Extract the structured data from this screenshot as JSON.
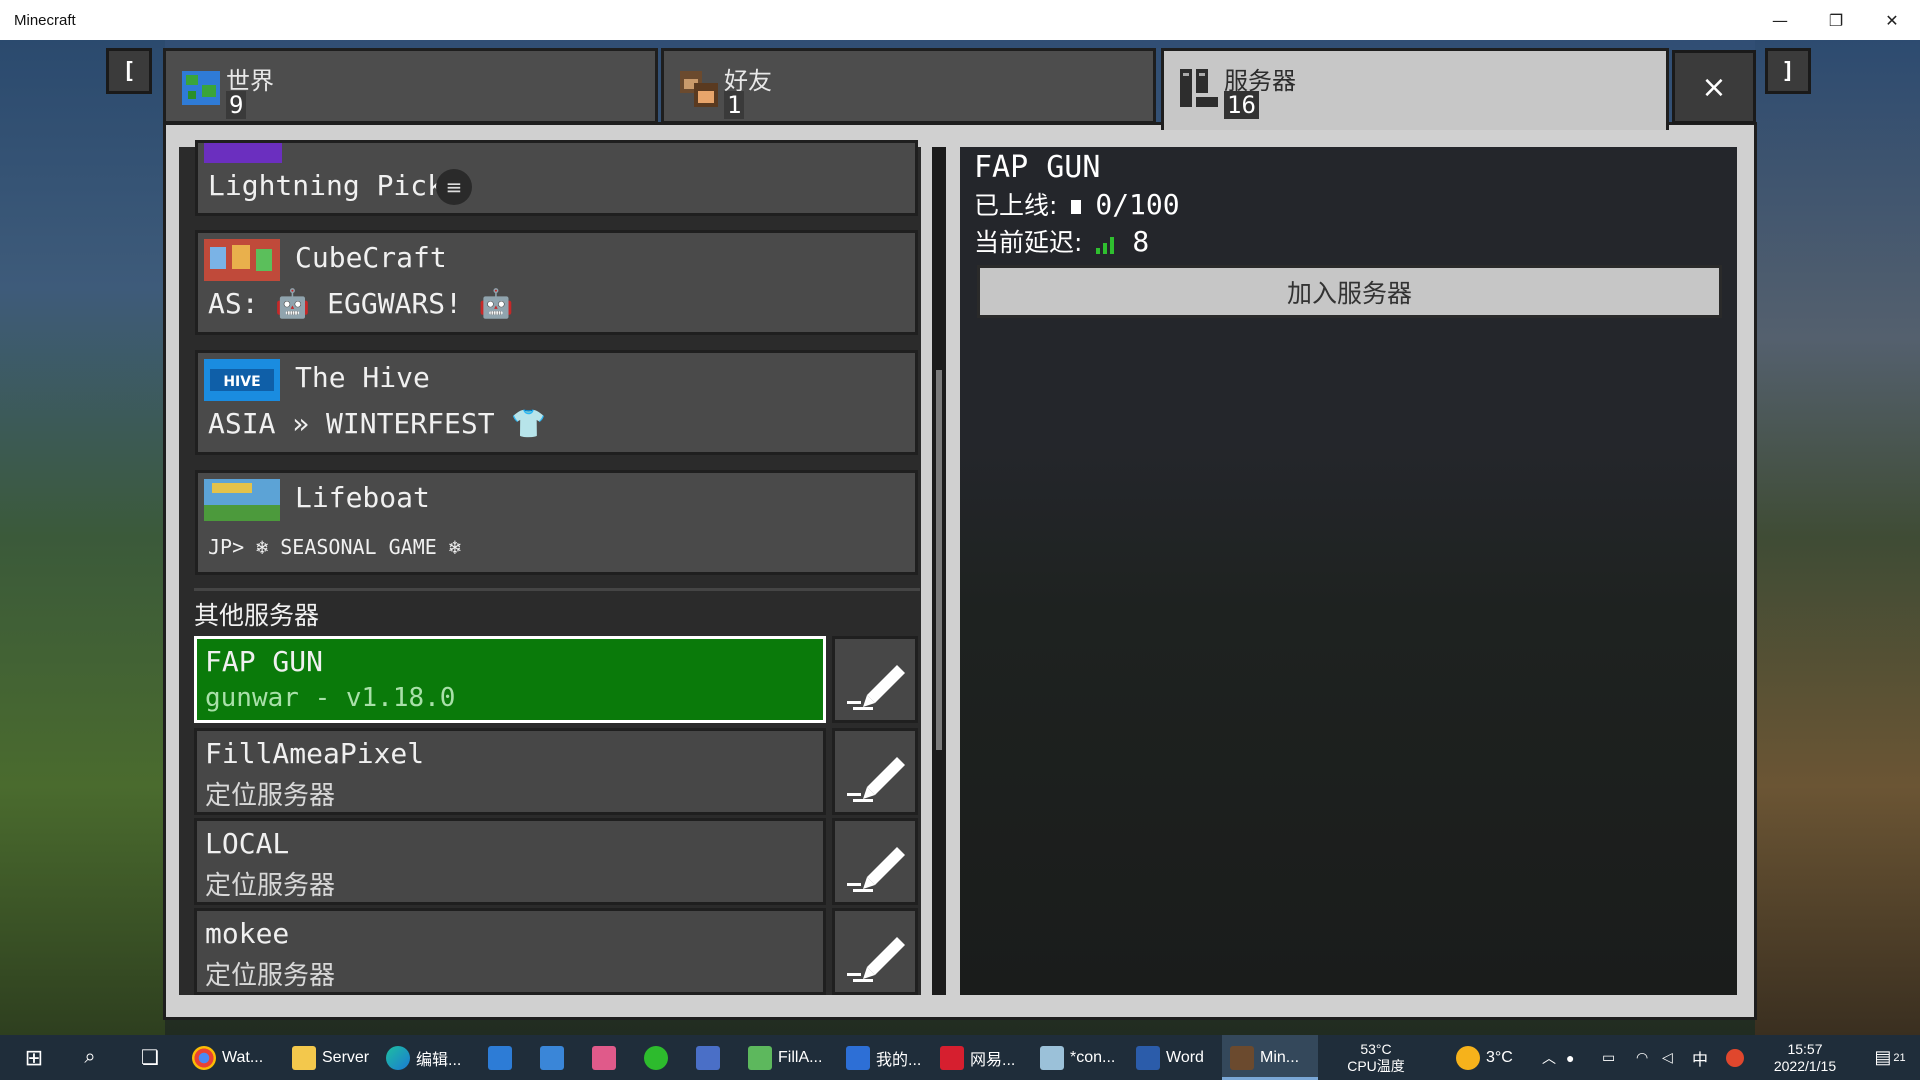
{
  "window": {
    "title": "Minecraft",
    "minimize": "—",
    "maximize": "❐",
    "close": "✕"
  },
  "tabs": [
    {
      "label": "世界",
      "count": "9"
    },
    {
      "label": "好友",
      "count": "1"
    },
    {
      "label": "服务器",
      "count": "16"
    }
  ],
  "nav": {
    "left": "[",
    "right": "]",
    "close": "×"
  },
  "featured_servers": [
    {
      "name": "",
      "sub": "Lightning Pick!",
      "menu_icon": "≡"
    },
    {
      "name": "CubeCraft",
      "sub": "AS: 🤖 EGGWARS! 🤖"
    },
    {
      "name": "The Hive",
      "sub": "ASIA » WINTERFEST 👕"
    },
    {
      "name": "Lifeboat",
      "sub": "JP> ❄ SEASONAL GAME ❄"
    }
  ],
  "other_servers_title": "其他服务器",
  "other_servers": [
    {
      "name": "FAP GUN",
      "sub": "gunwar - v1.18.0"
    },
    {
      "name": "FillAmeaPixel",
      "sub": "定位服务器"
    },
    {
      "name": "LOCAL",
      "sub": "定位服务器"
    },
    {
      "name": "mokee",
      "sub": "定位服务器"
    }
  ],
  "detail": {
    "name": "FAP GUN",
    "online_label": "已上线:",
    "online_value": "0/100",
    "latency_label": "当前延迟:",
    "latency_value": "8",
    "join_label": "加入服务器"
  },
  "taskbar": {
    "items": [
      "Wat...",
      "Server",
      "编辑...",
      "FillA...",
      "我的...",
      "网易...",
      "*con...",
      "Word",
      "Min..."
    ],
    "cpu_temp": "53°C",
    "cpu_label": "CPU温度",
    "weather": "3°C",
    "ime": "中",
    "time": "15:57",
    "date": "2022/1/15",
    "notif": "21"
  },
  "colors": {
    "selected": "#0a7a0a",
    "latency": "#2fbf2f"
  }
}
